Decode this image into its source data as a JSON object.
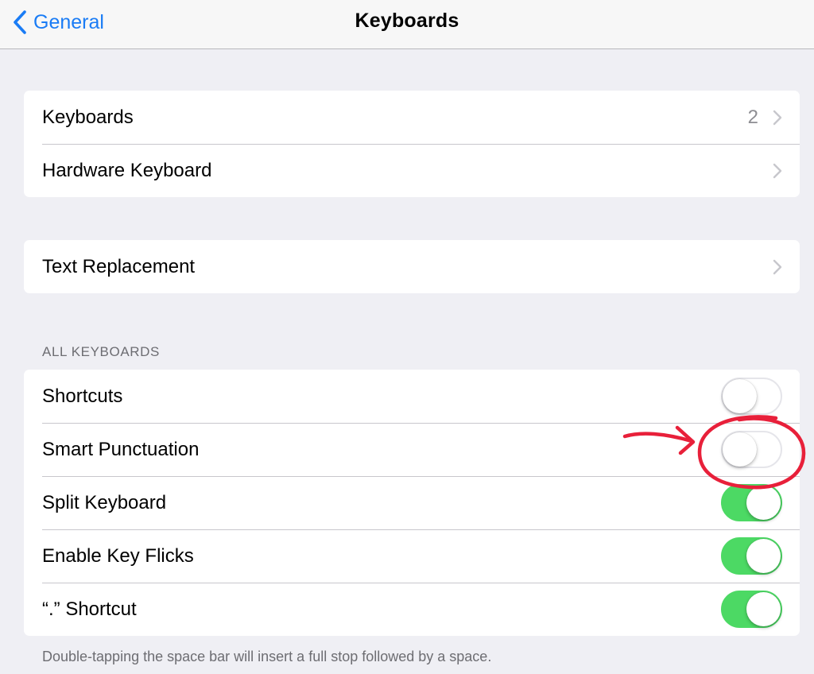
{
  "navbar": {
    "back_label": "General",
    "title": "Keyboards"
  },
  "group1": {
    "keyboards": {
      "label": "Keyboards",
      "detail": "2"
    },
    "hardware_keyboard": {
      "label": "Hardware Keyboard"
    }
  },
  "group2": {
    "text_replacement": {
      "label": "Text Replacement"
    }
  },
  "all_keyboards": {
    "header": "ALL KEYBOARDS",
    "rows": [
      {
        "label": "Shortcuts",
        "on": false
      },
      {
        "label": "Smart Punctuation",
        "on": false
      },
      {
        "label": "Split Keyboard",
        "on": true
      },
      {
        "label": "Enable Key Flicks",
        "on": true
      },
      {
        "label": "“.” Shortcut",
        "on": true
      }
    ],
    "footer": "Double-tapping the space bar will insert a full stop followed by a space."
  },
  "colors": {
    "accent": "#1a7cf5",
    "switch_on": "#4cd964",
    "annotation": "#e8203a"
  },
  "icons": {
    "back": "chevron-left-icon",
    "disclosure": "chevron-right-icon"
  }
}
